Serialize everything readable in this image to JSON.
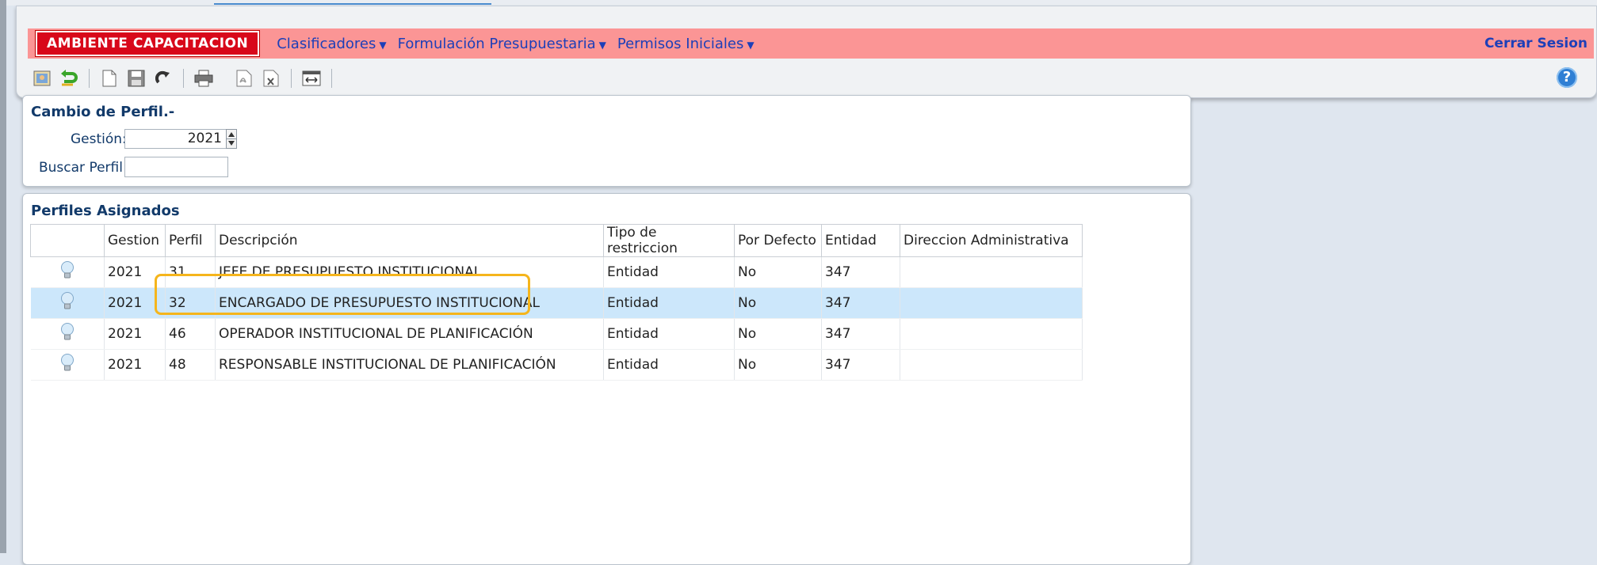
{
  "header": {
    "environment_badge": "AMBIENTE CAPACITACION",
    "menu": [
      {
        "label": "Clasificadores"
      },
      {
        "label": "Formulación Presupuestaria"
      },
      {
        "label": "Permisos Iniciales"
      }
    ],
    "logout_label": "Cerrar Sesion",
    "help_label": "?"
  },
  "toolbar": {
    "icons": [
      "preview-icon",
      "undo-icon",
      "new-document-icon",
      "save-icon",
      "redo-icon",
      "print-icon",
      "pdf-icon",
      "excel-icon",
      "fit-window-icon"
    ]
  },
  "profile_change": {
    "title": "Cambio de Perfil.-",
    "gestion_label": "Gestión:",
    "gestion_value": "2021",
    "search_label": "Buscar Perfil:",
    "search_value": ""
  },
  "assigned_profiles": {
    "title": "Perfiles Asignados",
    "columns": [
      "",
      "Gestion",
      "Perfil",
      "Descripción",
      "Tipo de restriccion",
      "Por Defecto",
      "Entidad",
      "Direccion Administrativa"
    ],
    "rows": [
      {
        "gestion": "2021",
        "perfil": "31",
        "descripcion": "JEFE DE PRESUPUESTO INSTITUCIONAL",
        "tipo": "Entidad",
        "defecto": "No",
        "entidad": "347",
        "direccion": ""
      },
      {
        "gestion": "2021",
        "perfil": "32",
        "descripcion": "ENCARGADO DE PRESUPUESTO INSTITUCIONAL",
        "tipo": "Entidad",
        "defecto": "No",
        "entidad": "347",
        "direccion": ""
      },
      {
        "gestion": "2021",
        "perfil": "46",
        "descripcion": "OPERADOR INSTITUCIONAL DE PLANIFICACIÓN",
        "tipo": "Entidad",
        "defecto": "No",
        "entidad": "347",
        "direccion": ""
      },
      {
        "gestion": "2021",
        "perfil": "48",
        "descripcion": "RESPONSABLE INSTITUCIONAL DE PLANIFICACIÓN",
        "tipo": "Entidad",
        "defecto": "No",
        "entidad": "347",
        "direccion": ""
      }
    ],
    "selected_row": 1
  },
  "colors": {
    "menubar": "#fb9595",
    "badge": "#d8081a",
    "link": "#1d3fb8",
    "selected_row": "#cce7fb",
    "highlight": "#f5b51c"
  }
}
